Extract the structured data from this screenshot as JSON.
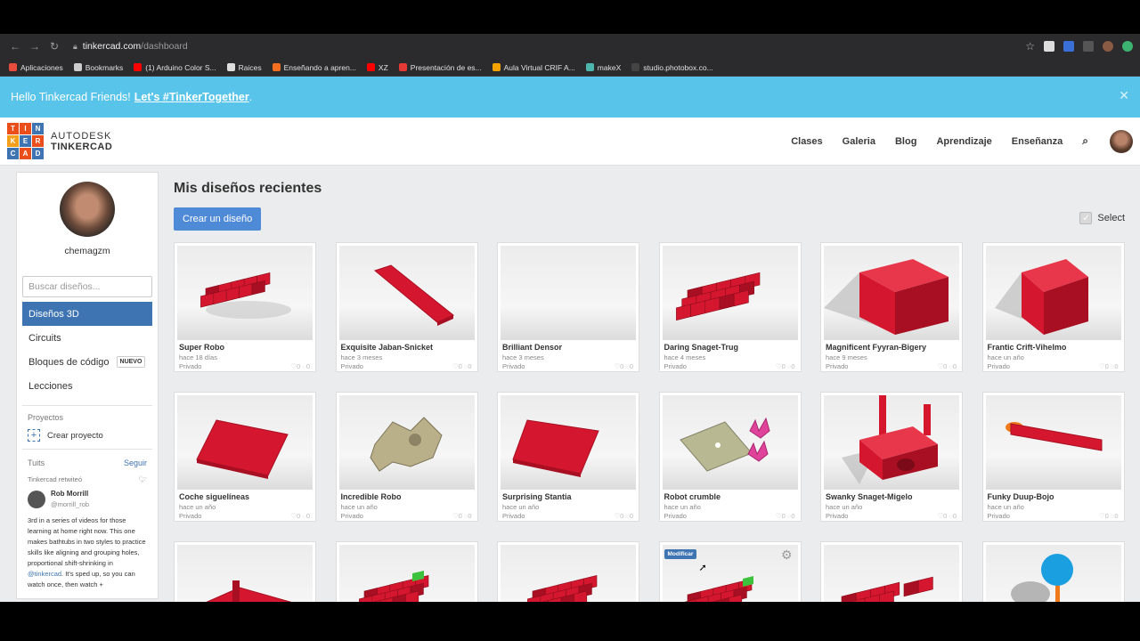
{
  "browser": {
    "url_host": "tinkercad.com",
    "url_path": "/dashboard",
    "bookmarks": [
      {
        "label": "Aplicaciones",
        "color": "#e84c3d"
      },
      {
        "label": "Bookmarks",
        "color": "#cccccc"
      },
      {
        "label": "(1) Arduino Color S...",
        "color": "#ff0000"
      },
      {
        "label": "Raices",
        "color": "#dddddd"
      },
      {
        "label": "Enseñando a apren...",
        "color": "#f26f21"
      },
      {
        "label": "XZ",
        "color": "#ff0000"
      },
      {
        "label": "Presentación de es...",
        "color": "#e53935"
      },
      {
        "label": "Aula Virtual CRIF A...",
        "color": "#f4a300"
      },
      {
        "label": "makeX",
        "color": "#4db6ac"
      },
      {
        "label": "studio.photobox.co...",
        "color": "#444444"
      }
    ]
  },
  "banner": {
    "text": "Hello Tinkercad Friends!",
    "link": "Let's #TinkerTogether",
    "suffix": "."
  },
  "header": {
    "brand_top": "AUTODESK",
    "brand_bottom": "TINKERCAD",
    "logo_letters": [
      "T",
      "I",
      "N",
      "K",
      "E",
      "R",
      "C",
      "A",
      "D"
    ],
    "logo_colors": [
      "#e94e1b",
      "#e94e1b",
      "#3e74b2",
      "#f5a01a",
      "#3e74b2",
      "#e94e1b",
      "#3e74b2",
      "#e94e1b",
      "#3e74b2"
    ],
    "nav": [
      "Clases",
      "Galeria",
      "Blog",
      "Aprendizaje",
      "Enseñanza"
    ]
  },
  "sidebar": {
    "username": "chemagzm",
    "search_placeholder": "Buscar diseños...",
    "items": [
      {
        "label": "Diseños 3D"
      },
      {
        "label": "Circuits"
      },
      {
        "label": "Bloques de código",
        "badge": "NUEVO"
      },
      {
        "label": "Lecciones"
      }
    ],
    "projects_title": "Proyectos",
    "create_project": "Crear proyecto",
    "tuits_title": "Tuits",
    "follow": "Seguir",
    "tweet": {
      "retweet": "Tinkercad retwiteó",
      "name": "Rob Morrill",
      "handle": "@morrill_rob",
      "text_a": "3rd in a series of videos for those learning at home right now. This one makes bathtubs in two styles to practice skills like aligning and grouping holes, proportional shift-shrinking in",
      "link": "@tinkercad",
      "text_b": ". It's sped up, so you can watch once, then watch +"
    }
  },
  "main": {
    "title": "Mis diseños recientes",
    "create_button": "Crear un diseño",
    "select_label": "Select",
    "edit_badge": "Modificar",
    "designs": [
      {
        "name": "Super Robo",
        "time": "hace 18 días",
        "privacy": "Privado",
        "stats": "♡0 ◌0"
      },
      {
        "name": "Exquisite Jaban-Snicket",
        "time": "hace 3 meses",
        "privacy": "Privado",
        "stats": "♡0 ◌0"
      },
      {
        "name": "Brilliant Densor",
        "time": "hace 3 meses",
        "privacy": "Privado",
        "stats": "♡0 ◌0"
      },
      {
        "name": "Daring Snaget-Trug",
        "time": "hace 4 meses",
        "privacy": "Privado",
        "stats": "♡0 ◌0"
      },
      {
        "name": "Magnificent Fyyran-Bigery",
        "time": "hace 9 meses",
        "privacy": "Privado",
        "stats": "♡0 ◌0"
      },
      {
        "name": "Frantic Crift-Vihelmo",
        "time": "hace un año",
        "privacy": "Privado",
        "stats": "♡0 ◌0"
      },
      {
        "name": "Coche siguelíneas",
        "time": "hace un año",
        "privacy": "Privado",
        "stats": "♡0 ◌0"
      },
      {
        "name": "Incredible Robo",
        "time": "hace un año",
        "privacy": "Privado",
        "stats": "♡0 ◌0"
      },
      {
        "name": "Surprising Stantia",
        "time": "hace un año",
        "privacy": "Privado",
        "stats": "♡0 ◌0"
      },
      {
        "name": "Robot crumble",
        "time": "hace un año",
        "privacy": "Privado",
        "stats": "♡0 ◌0"
      },
      {
        "name": "Swanky Snaget-Migelo",
        "time": "hace un año",
        "privacy": "Privado",
        "stats": "♡0 ◌0"
      },
      {
        "name": "Funky Duup-Bojo",
        "time": "hace un año",
        "privacy": "Privado",
        "stats": "♡0 ◌0"
      },
      {
        "name": "",
        "time": "",
        "privacy": "",
        "stats": ""
      },
      {
        "name": "",
        "time": "",
        "privacy": "",
        "stats": ""
      },
      {
        "name": "",
        "time": "",
        "privacy": "",
        "stats": ""
      },
      {
        "name": "",
        "time": "",
        "privacy": "",
        "stats": ""
      },
      {
        "name": "",
        "time": "",
        "privacy": "",
        "stats": ""
      },
      {
        "name": "",
        "time": "",
        "privacy": "",
        "stats": ""
      }
    ]
  }
}
